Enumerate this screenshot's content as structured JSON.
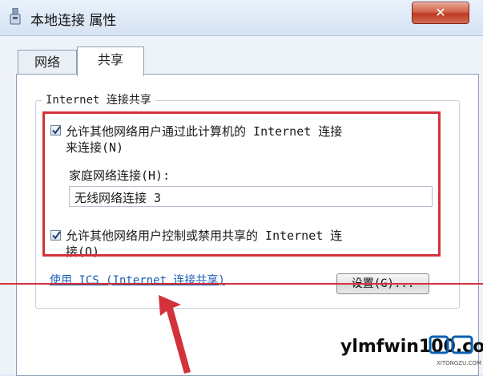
{
  "window": {
    "title": "本地连接 属性",
    "close_label": "✕"
  },
  "tabs": [
    {
      "label": "网络",
      "active": false
    },
    {
      "label": "共享",
      "active": true
    }
  ],
  "sharing": {
    "group_title": "Internet 连接共享",
    "allow_other_users": {
      "checked": true,
      "line1": "允许其他网络用户通过此计算机的 Internet 连接",
      "line2": "来连接(N)"
    },
    "home_network_label": "家庭网络连接(H):",
    "home_network_value": "无线网络连接 3",
    "allow_control": {
      "checked": true,
      "line1": "允许其他网络用户控制或禁用共享的 Internet 连",
      "line2": "接(O)"
    },
    "ics_link": "使用 ICS (Internet 连接共享)",
    "settings_button": "设置(G)..."
  },
  "watermark": {
    "text": "ylmfwin100.com",
    "sub": "XITONGZU.COM"
  },
  "colors": {
    "annotation_red": "#d3323a",
    "link_blue": "#1a5fb4"
  }
}
